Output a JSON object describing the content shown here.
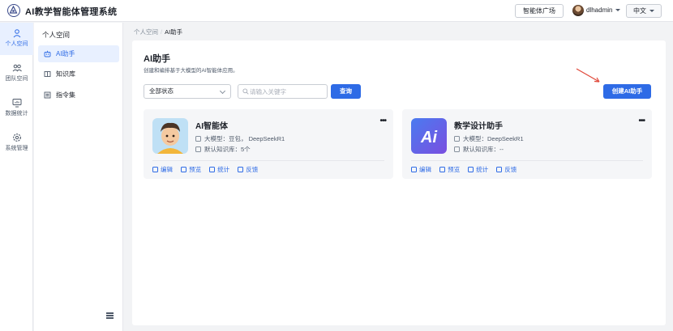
{
  "header": {
    "app_title": "AI教学智能体管理系统",
    "market_button": "智能体广场",
    "username": "dlhadmin",
    "language": "中文"
  },
  "rail": {
    "items": [
      {
        "label": "个人空间",
        "icon": "user-icon"
      },
      {
        "label": "团队空间",
        "icon": "team-icon"
      },
      {
        "label": "数据统计",
        "icon": "chart-monitor-icon"
      },
      {
        "label": "系统管理",
        "icon": "gear-icon"
      }
    ]
  },
  "sidebar": {
    "title": "个人空间",
    "items": [
      {
        "label": "AI助手",
        "icon": "robot-icon"
      },
      {
        "label": "知识库",
        "icon": "book-icon"
      },
      {
        "label": "指令集",
        "icon": "list-icon"
      }
    ]
  },
  "breadcrumb": {
    "root": "个人空间",
    "separator": "/",
    "current": "AI助手"
  },
  "main": {
    "title": "AI助手",
    "description": "创建和编排基于大模型的AI智能体应用。",
    "filter_select": "全部状态",
    "search_placeholder": "请输入关键字",
    "query_button": "查询",
    "create_button": "创建AI助手"
  },
  "cards": [
    {
      "name": "AI智能体",
      "model_label": "大模型：",
      "model_value": "豆包， DeepSeekR1",
      "kb_label": "默认知识库：",
      "kb_value": "5个",
      "actions": [
        "编辑",
        "预览",
        "统计",
        "反馈"
      ]
    },
    {
      "name": "教学设计助手",
      "thumb_text": "Ai",
      "model_label": "大模型：",
      "model_value": "DeepSeekR1",
      "kb_label": "默认知识库：",
      "kb_value": "--",
      "actions": [
        "编辑",
        "预览",
        "统计",
        "反馈"
      ]
    }
  ],
  "colors": {
    "accent": "#2e6be6",
    "annotation_arrow": "#e0483a"
  }
}
